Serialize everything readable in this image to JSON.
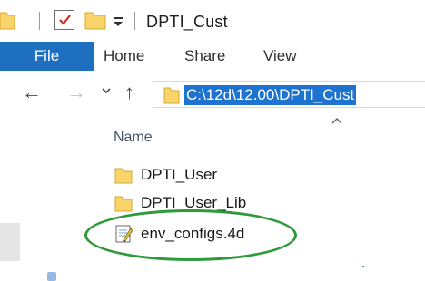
{
  "window": {
    "title": "DPTI_Cust"
  },
  "ribbon": {
    "tabs": [
      "File",
      "Home",
      "Share",
      "View"
    ]
  },
  "address_bar": {
    "path": "C:\\12d\\12.00\\DPTI_Cust"
  },
  "file_list": {
    "column_name": "Name",
    "items": [
      {
        "label": "DPTI_User",
        "icon": "folder-icon"
      },
      {
        "label": "DPTI_User_Lib",
        "icon": "folder-icon"
      },
      {
        "label": "env_configs.4d",
        "icon": "text-file-icon"
      }
    ]
  },
  "colors": {
    "file_tab": "#1f6fc0",
    "address_selection": "#1e73d0",
    "folder": "#f8d46a",
    "annotation": "#2e9a3a"
  }
}
